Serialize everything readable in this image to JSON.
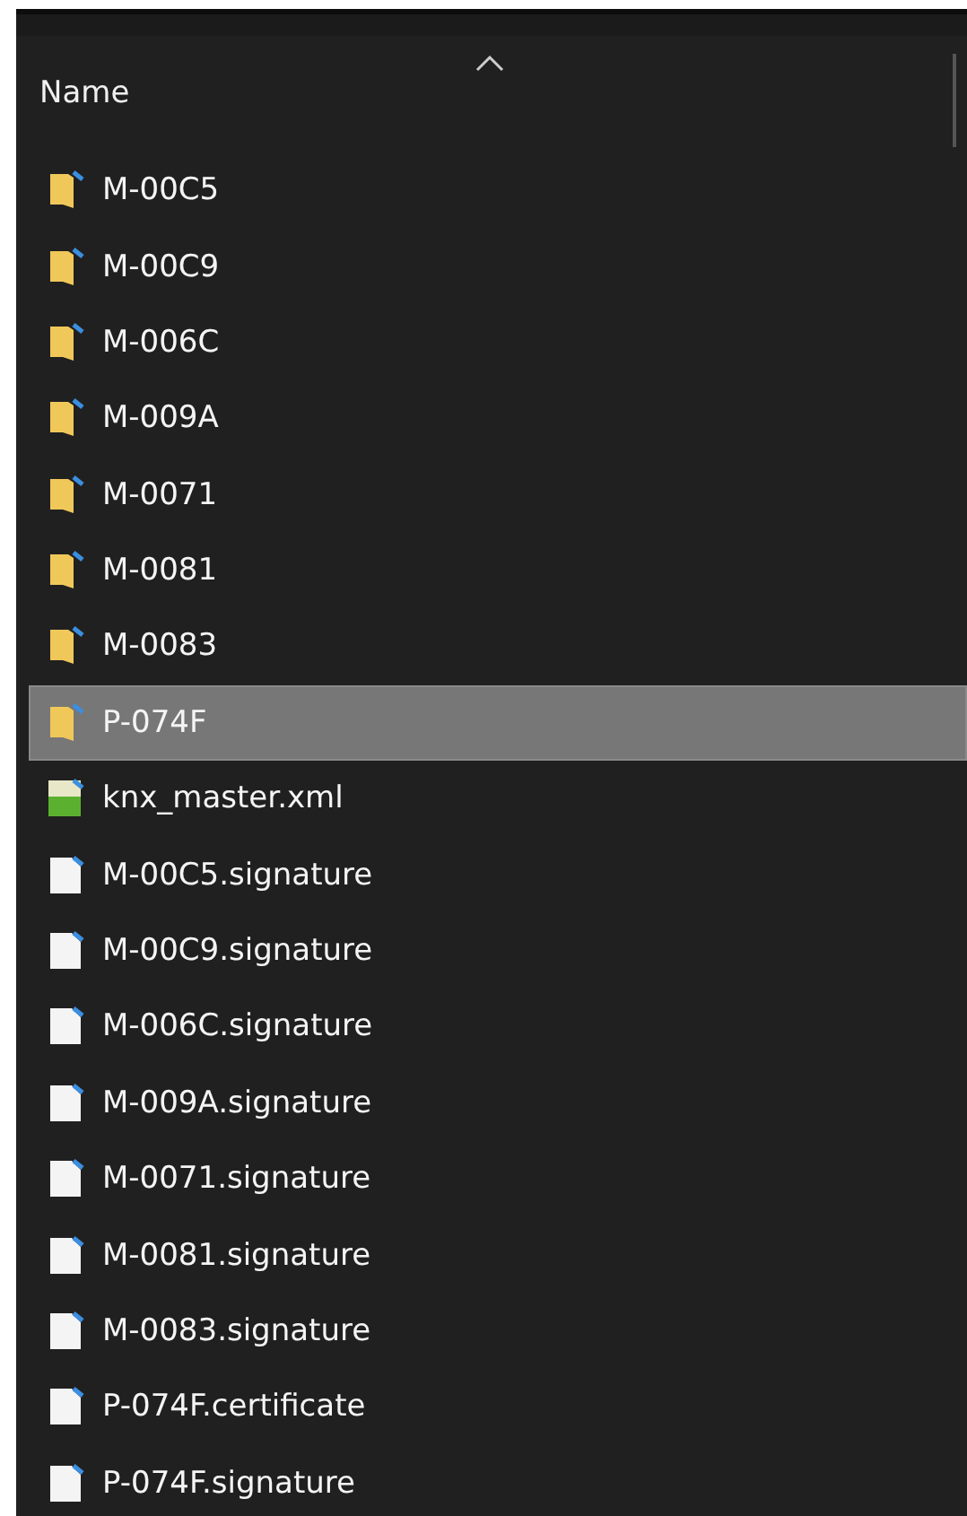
{
  "column": {
    "label": "Name",
    "sorted_ascending": true
  },
  "items": [
    {
      "name": "M-00C5",
      "kind": "folder",
      "selected": false
    },
    {
      "name": "M-00C9",
      "kind": "folder",
      "selected": false
    },
    {
      "name": "M-006C",
      "kind": "folder",
      "selected": false
    },
    {
      "name": "M-009A",
      "kind": "folder",
      "selected": false
    },
    {
      "name": "M-0071",
      "kind": "folder",
      "selected": false
    },
    {
      "name": "M-0081",
      "kind": "folder",
      "selected": false
    },
    {
      "name": "M-0083",
      "kind": "folder",
      "selected": false
    },
    {
      "name": "P-074F",
      "kind": "folder",
      "selected": true
    },
    {
      "name": "knx_master.xml",
      "kind": "xml",
      "selected": false
    },
    {
      "name": "M-00C5.signature",
      "kind": "file",
      "selected": false
    },
    {
      "name": "M-00C9.signature",
      "kind": "file",
      "selected": false
    },
    {
      "name": "M-006C.signature",
      "kind": "file",
      "selected": false
    },
    {
      "name": "M-009A.signature",
      "kind": "file",
      "selected": false
    },
    {
      "name": "M-0071.signature",
      "kind": "file",
      "selected": false
    },
    {
      "name": "M-0081.signature",
      "kind": "file",
      "selected": false
    },
    {
      "name": "M-0083.signature",
      "kind": "file",
      "selected": false
    },
    {
      "name": "P-074F.certificate",
      "kind": "file",
      "selected": false
    },
    {
      "name": "P-074F.signature",
      "kind": "file",
      "selected": false
    }
  ]
}
